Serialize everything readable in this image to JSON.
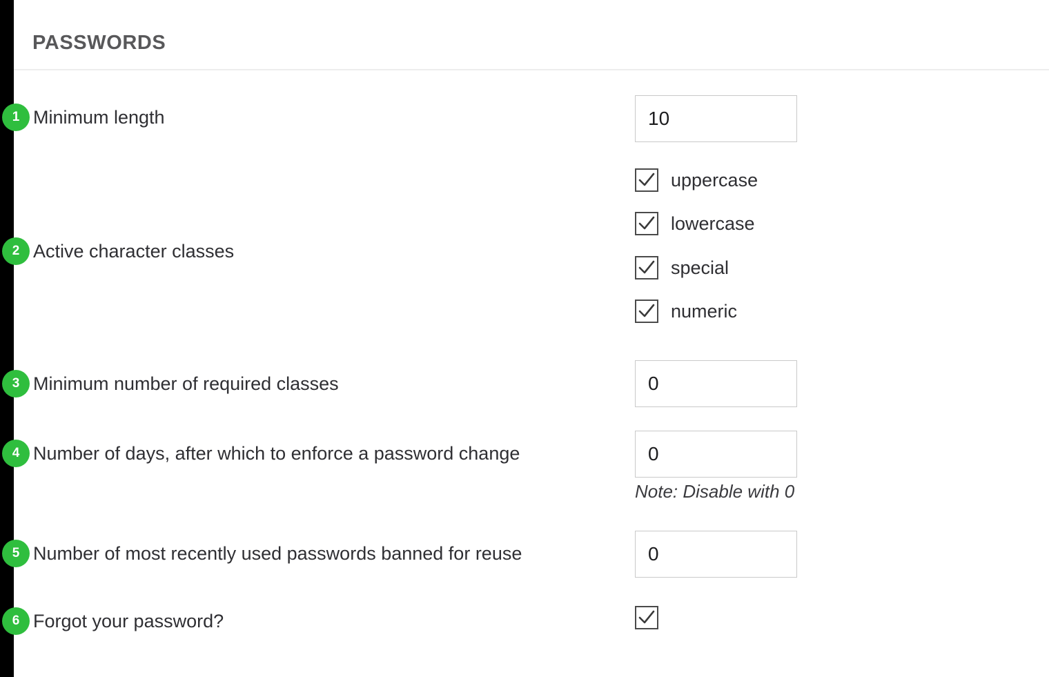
{
  "section": {
    "title": "PASSWORDS"
  },
  "rows": [
    {
      "badge": "1",
      "label": "Minimum length",
      "control": "input",
      "value": "10"
    },
    {
      "badge": "2",
      "label": "Active character classes",
      "control": "checkbox-group",
      "options": [
        {
          "label": "uppercase",
          "checked": true
        },
        {
          "label": "lowercase",
          "checked": true
        },
        {
          "label": "special",
          "checked": true
        },
        {
          "label": "numeric",
          "checked": true
        }
      ]
    },
    {
      "badge": "3",
      "label": "Minimum number of required classes",
      "control": "input",
      "value": "0"
    },
    {
      "badge": "4",
      "label": "Number of days, after which to enforce a password change",
      "control": "input",
      "value": "0",
      "note": "Note: Disable with 0"
    },
    {
      "badge": "5",
      "label": "Number of most recently used passwords banned for reuse",
      "control": "input",
      "value": "0"
    },
    {
      "badge": "6",
      "label": "Forgot your password?",
      "control": "checkbox",
      "checked": true
    }
  ],
  "colors": {
    "badge_green": "#2fbe3e",
    "rail_black": "#000000",
    "label_text": "#2f2f33",
    "heading_text": "#58585a",
    "input_border": "#c9c9c9",
    "checkbox_border": "#4a4a4a",
    "rule": "#ededed"
  }
}
